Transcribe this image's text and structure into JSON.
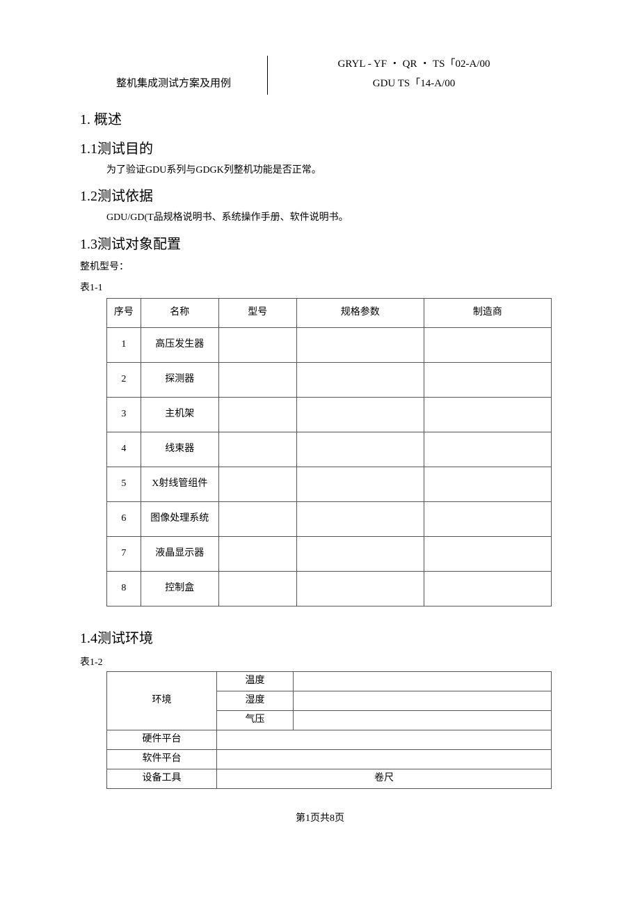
{
  "header": {
    "left_title": "整机集成测试方案及用例",
    "right_line1": "GRYL - YF ・ QR ・ TS「02-A/00",
    "right_line2": "GDU TS「14-A/00"
  },
  "sections": {
    "s1": "1. 概述",
    "s1_1": "1.1测试目的",
    "s1_1_body": "为了验证GDU系列与GDGK列整机功能是否正常。",
    "s1_2": "1.2测试依据",
    "s1_2_body": "GDU/GD(T品规格说明书、系统操作手册、软件说明书。",
    "s1_3": "1.3测试对象配置",
    "s1_3_label": "整机型号：",
    "s1_4": "1.4测试环境"
  },
  "table1": {
    "caption": "表1-1",
    "headers": {
      "seq": "序号",
      "name": "名称",
      "model": "型号",
      "spec": "规格参数",
      "mfr": "制造商"
    },
    "rows": [
      {
        "seq": "1",
        "name": "高压发生器",
        "model": "",
        "spec": "",
        "mfr": ""
      },
      {
        "seq": "2",
        "name": "探测器",
        "model": "",
        "spec": "",
        "mfr": ""
      },
      {
        "seq": "3",
        "name": "主机架",
        "model": "",
        "spec": "",
        "mfr": ""
      },
      {
        "seq": "4",
        "name": "线束器",
        "model": "",
        "spec": "",
        "mfr": ""
      },
      {
        "seq": "5",
        "name": "X射线管组件",
        "model": "",
        "spec": "",
        "mfr": ""
      },
      {
        "seq": "6",
        "name": "图像处理系统",
        "model": "",
        "spec": "",
        "mfr": ""
      },
      {
        "seq": "7",
        "name": "液晶显示器",
        "model": "",
        "spec": "",
        "mfr": ""
      },
      {
        "seq": "8",
        "name": "控制盒",
        "model": "",
        "spec": "",
        "mfr": ""
      }
    ]
  },
  "table2": {
    "caption": "表1-2",
    "env_label": "环境",
    "env_rows": [
      {
        "label": "温度",
        "value": ""
      },
      {
        "label": "湿度",
        "value": ""
      },
      {
        "label": "气压",
        "value": ""
      }
    ],
    "rows": [
      {
        "label": "硬件平台",
        "value": ""
      },
      {
        "label": "软件平台",
        "value": ""
      },
      {
        "label": "设备工具",
        "value": "卷尺"
      }
    ]
  },
  "footer": "第1页共8页"
}
